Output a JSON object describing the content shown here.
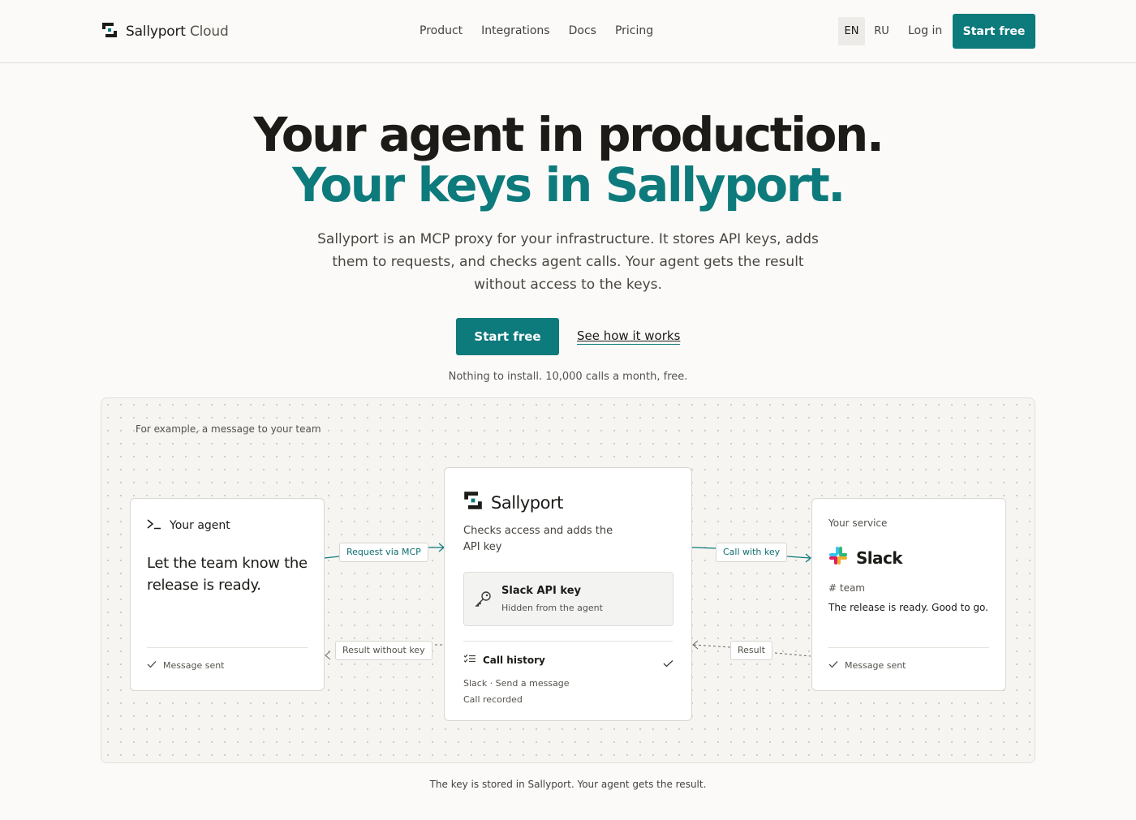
{
  "header": {
    "brand_main": "Sallyport",
    "brand_suffix": " Cloud",
    "nav": [
      "Product",
      "Integrations",
      "Docs",
      "Pricing"
    ],
    "lang_en": "EN",
    "lang_ru": "RU",
    "login": "Log in",
    "cta": "Start free"
  },
  "hero": {
    "title_line1": "Your agent in production.",
    "title_line2": "Your keys in Sallyport.",
    "lead": "Sallyport is an MCP proxy for your infrastructure. It stores API keys, adds them to requests, and checks agent calls. Your agent gets the result without access to the keys.",
    "cta_primary": "Start free",
    "cta_secondary": "See how it works",
    "note": "Nothing to install. 10,000 calls a month, free."
  },
  "diagram": {
    "label": "For example, a message to your team",
    "agent": {
      "title": "Your agent",
      "message": "Let the team know the release is ready.",
      "status": "Message sent"
    },
    "sallyport": {
      "title": "Sallyport",
      "description": "Checks access and adds the API key",
      "key_title": "Slack API key",
      "key_subtitle": "Hidden from the agent",
      "history_title": "Call history",
      "history_line1": "Slack · Send a message",
      "history_line2": "Call recorded"
    },
    "service": {
      "label": "Your service",
      "name": "Slack",
      "channel": "# team",
      "message": "The release is ready. Good to go.",
      "status": "Message sent"
    },
    "connectors": {
      "request": "Request via MCP",
      "call": "Call with key",
      "result_no_key": "Result without key",
      "result": "Result"
    },
    "footnote": "The key is stored in Sallyport. Your agent gets the result."
  },
  "colors": {
    "accent": "#0d7a7c",
    "background": "#fbfaf8",
    "text": "#1c1b18"
  },
  "icons": {
    "logo": "sallyport-logo-icon",
    "terminal": "terminal-icon",
    "key": "key-icon",
    "history": "checklist-icon",
    "check": "check-icon",
    "slack": "slack-logo-icon"
  }
}
